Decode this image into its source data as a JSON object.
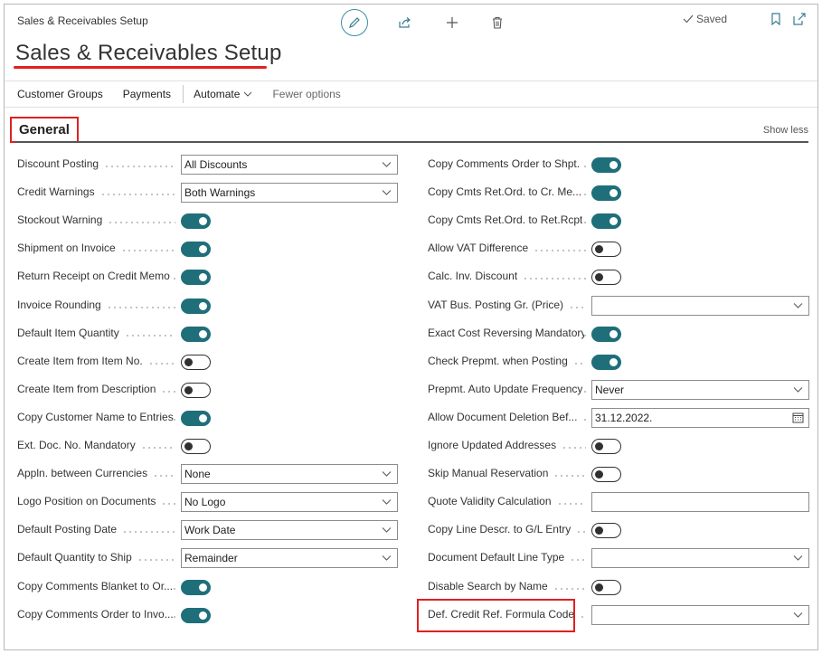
{
  "breadcrumb": "Sales & Receivables Setup",
  "page_title": "Sales & Receivables Setup",
  "status": {
    "saved": "Saved"
  },
  "actions": {
    "customer_groups": "Customer Groups",
    "payments": "Payments",
    "automate": "Automate",
    "fewer_options": "Fewer options"
  },
  "section": {
    "title": "General",
    "show_less": "Show less"
  },
  "left_fields": [
    {
      "label": "Discount Posting",
      "type": "select",
      "value": "All Discounts"
    },
    {
      "label": "Credit Warnings",
      "type": "select",
      "value": "Both Warnings"
    },
    {
      "label": "Stockout Warning",
      "type": "toggle",
      "on": true
    },
    {
      "label": "Shipment on Invoice",
      "type": "toggle",
      "on": true
    },
    {
      "label": "Return Receipt on Credit Memo",
      "type": "toggle",
      "on": true
    },
    {
      "label": "Invoice Rounding",
      "type": "toggle",
      "on": true
    },
    {
      "label": "Default Item Quantity",
      "type": "toggle",
      "on": true
    },
    {
      "label": "Create Item from Item No.",
      "type": "toggle",
      "on": false
    },
    {
      "label": "Create Item from Description",
      "type": "toggle",
      "on": false
    },
    {
      "label": "Copy Customer Name to Entries",
      "type": "toggle",
      "on": true
    },
    {
      "label": "Ext. Doc. No. Mandatory",
      "type": "toggle",
      "on": false
    },
    {
      "label": "Appln. between Currencies",
      "type": "select",
      "value": "None"
    },
    {
      "label": "Logo Position on Documents",
      "type": "select",
      "value": "No Logo"
    },
    {
      "label": "Default Posting Date",
      "type": "select",
      "value": "Work Date"
    },
    {
      "label": "Default Quantity to Ship",
      "type": "select",
      "value": "Remainder"
    },
    {
      "label": "Copy Comments Blanket to Or...",
      "type": "toggle",
      "on": true
    },
    {
      "label": "Copy Comments Order to Invo...",
      "type": "toggle",
      "on": true
    }
  ],
  "right_fields": [
    {
      "label": "Copy Comments Order to Shpt.",
      "type": "toggle",
      "on": true
    },
    {
      "label": "Copy Cmts Ret.Ord. to Cr. Me...",
      "type": "toggle",
      "on": true
    },
    {
      "label": "Copy Cmts Ret.Ord. to Ret.Rcpt",
      "type": "toggle",
      "on": true
    },
    {
      "label": "Allow VAT Difference",
      "type": "toggle",
      "on": false
    },
    {
      "label": "Calc. Inv. Discount",
      "type": "toggle",
      "on": false
    },
    {
      "label": "VAT Bus. Posting Gr. (Price)",
      "type": "select",
      "value": ""
    },
    {
      "label": "Exact Cost Reversing Mandatory",
      "type": "toggle",
      "on": true
    },
    {
      "label": "Check Prepmt. when Posting",
      "type": "toggle",
      "on": true
    },
    {
      "label": "Prepmt. Auto Update Frequency",
      "type": "select",
      "value": "Never"
    },
    {
      "label": "Allow Document Deletion Bef...",
      "type": "date",
      "value": "31.12.2022."
    },
    {
      "label": "Ignore Updated Addresses",
      "type": "toggle",
      "on": false
    },
    {
      "label": "Skip Manual Reservation",
      "type": "toggle",
      "on": false
    },
    {
      "label": "Quote Validity Calculation",
      "type": "text",
      "value": ""
    },
    {
      "label": "Copy Line Descr. to G/L Entry",
      "type": "toggle",
      "on": false
    },
    {
      "label": "Document Default Line Type",
      "type": "select",
      "value": ""
    },
    {
      "label": "Disable Search by Name",
      "type": "toggle",
      "on": false
    },
    {
      "label": "Def. Credit Ref. Formula Code",
      "type": "select",
      "value": ""
    }
  ],
  "colors": {
    "accent": "#1f6f7a",
    "highlight": "#e02020",
    "icon": "#3a7d93"
  }
}
